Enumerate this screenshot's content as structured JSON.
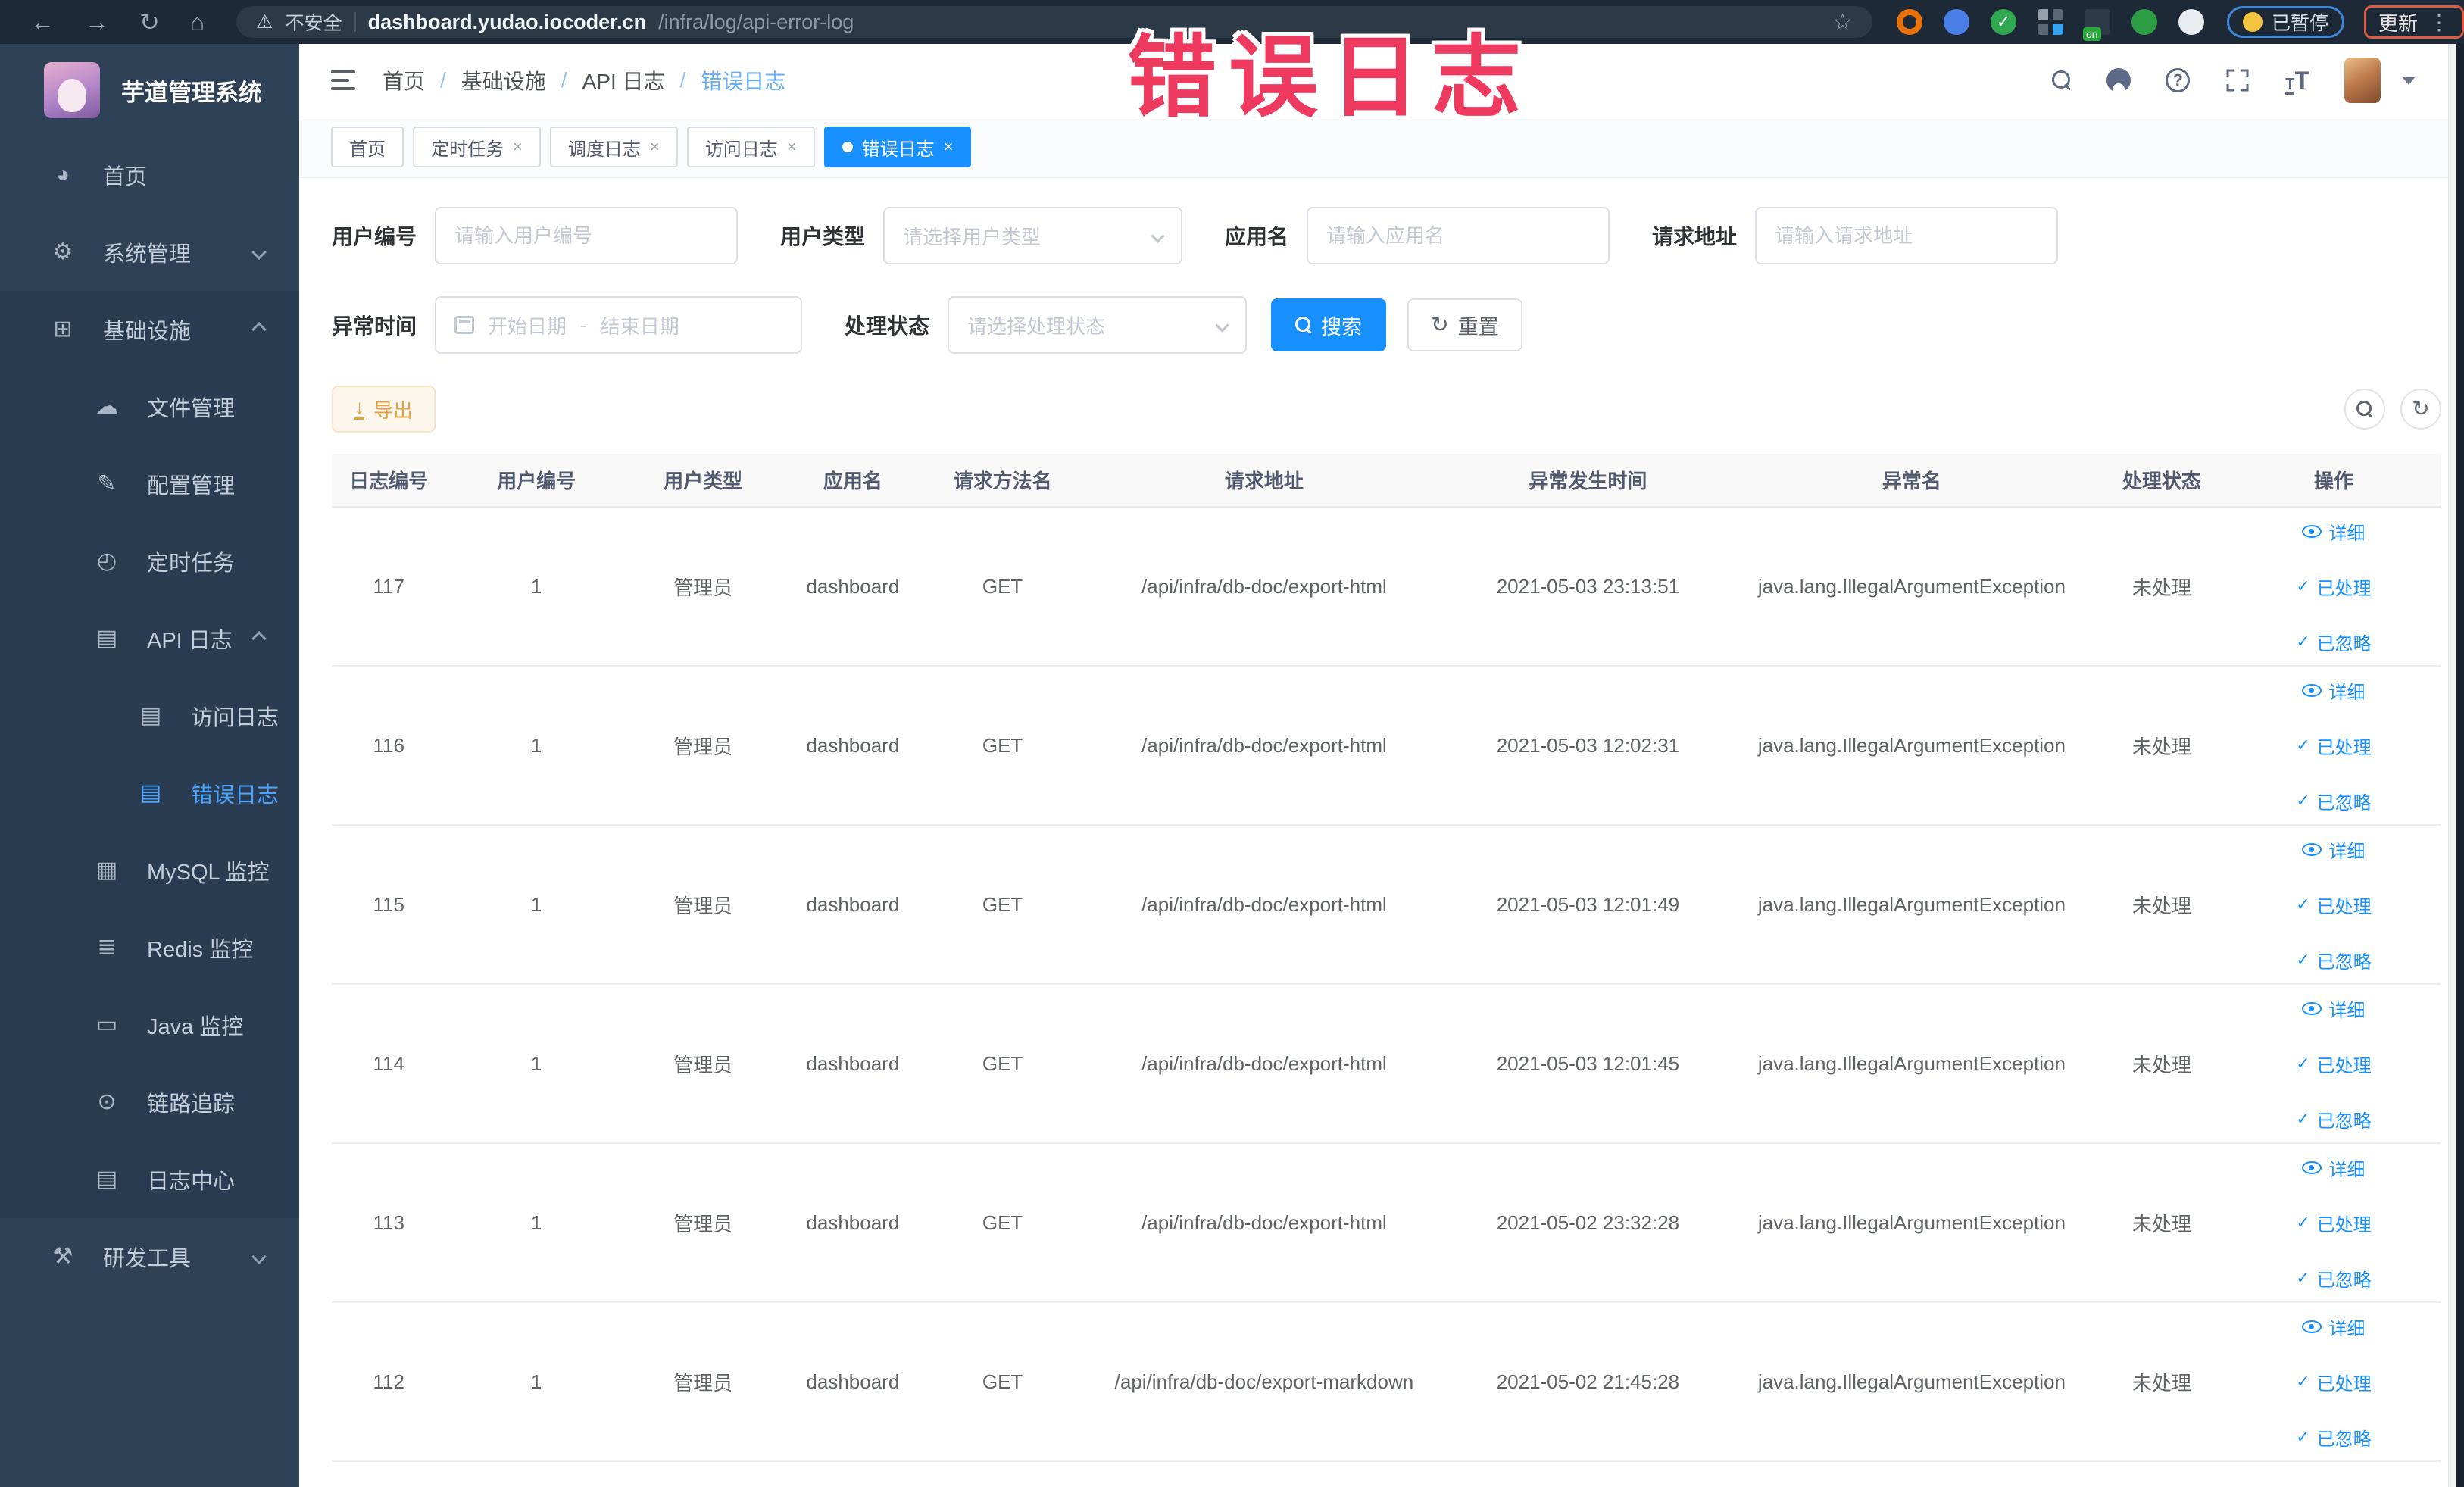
{
  "browser": {
    "security_label": "不安全",
    "url_host": "dashboard.yudao.iocoder.cn",
    "url_path": "/infra/log/api-error-log",
    "extension_badge": "on",
    "paused_badge": "已暂停",
    "update_label": "更新"
  },
  "annotation": {
    "title": "错误日志",
    "color": "#ee3a5f"
  },
  "sidebar": {
    "logo_title": "芋道管理系统",
    "items": [
      {
        "label": "首页"
      },
      {
        "label": "系统管理"
      },
      {
        "label": "基础设施"
      },
      {
        "label": "文件管理"
      },
      {
        "label": "配置管理"
      },
      {
        "label": "定时任务"
      },
      {
        "label": "API 日志"
      },
      {
        "label": "访问日志"
      },
      {
        "label": "错误日志"
      },
      {
        "label": "MySQL 监控"
      },
      {
        "label": "Redis 监控"
      },
      {
        "label": "Java 监控"
      },
      {
        "label": "链路追踪"
      },
      {
        "label": "日志中心"
      },
      {
        "label": "研发工具"
      }
    ]
  },
  "header": {
    "breadcrumb": [
      "首页",
      "基础设施",
      "API 日志",
      "错误日志"
    ],
    "separator": "/"
  },
  "tabs": [
    {
      "label": "首页"
    },
    {
      "label": "定时任务"
    },
    {
      "label": "调度日志"
    },
    {
      "label": "访问日志"
    },
    {
      "label": "错误日志"
    }
  ],
  "filters": {
    "user_id": {
      "label": "用户编号",
      "placeholder": "请输入用户编号"
    },
    "user_type": {
      "label": "用户类型",
      "placeholder": "请选择用户类型"
    },
    "app_name": {
      "label": "应用名",
      "placeholder": "请输入应用名"
    },
    "request_url": {
      "label": "请求地址",
      "placeholder": "请输入请求地址"
    },
    "exception_time": {
      "label": "异常时间",
      "start_placeholder": "开始日期",
      "separator": "-",
      "end_placeholder": "结束日期"
    },
    "process_status": {
      "label": "处理状态",
      "placeholder": "请选择处理状态"
    },
    "search_label": "搜索",
    "reset_label": "重置"
  },
  "toolbar": {
    "export_label": "导出"
  },
  "table": {
    "columns": [
      "日志编号",
      "用户编号",
      "用户类型",
      "应用名",
      "请求方法名",
      "请求地址",
      "异常发生时间",
      "异常名",
      "处理状态",
      "操作"
    ],
    "actions": [
      {
        "label": "详细"
      },
      {
        "label": "已处理"
      },
      {
        "label": "已忽略"
      }
    ],
    "rows": [
      {
        "id": "117",
        "user_id": "1",
        "user_type": "管理员",
        "app": "dashboard",
        "method": "GET",
        "url": "/api/infra/db-doc/export-html",
        "time": "2021-05-03 23:13:51",
        "exception": "java.lang.IllegalArgumentException",
        "status": "未处理"
      },
      {
        "id": "116",
        "user_id": "1",
        "user_type": "管理员",
        "app": "dashboard",
        "method": "GET",
        "url": "/api/infra/db-doc/export-html",
        "time": "2021-05-03 12:02:31",
        "exception": "java.lang.IllegalArgumentException",
        "status": "未处理"
      },
      {
        "id": "115",
        "user_id": "1",
        "user_type": "管理员",
        "app": "dashboard",
        "method": "GET",
        "url": "/api/infra/db-doc/export-html",
        "time": "2021-05-03 12:01:49",
        "exception": "java.lang.IllegalArgumentException",
        "status": "未处理"
      },
      {
        "id": "114",
        "user_id": "1",
        "user_type": "管理员",
        "app": "dashboard",
        "method": "GET",
        "url": "/api/infra/db-doc/export-html",
        "time": "2021-05-03 12:01:45",
        "exception": "java.lang.IllegalArgumentException",
        "status": "未处理"
      },
      {
        "id": "113",
        "user_id": "1",
        "user_type": "管理员",
        "app": "dashboard",
        "method": "GET",
        "url": "/api/infra/db-doc/export-html",
        "time": "2021-05-02 23:32:28",
        "exception": "java.lang.IllegalArgumentException",
        "status": "未处理"
      },
      {
        "id": "112",
        "user_id": "1",
        "user_type": "管理员",
        "app": "dashboard",
        "method": "GET",
        "url": "/api/infra/db-doc/export-markdown",
        "time": "2021-05-02 21:45:28",
        "exception": "java.lang.IllegalArgumentException",
        "status": "未处理"
      }
    ]
  },
  "colors": {
    "primary": "#1890ff",
    "sidebar_bg": "#2f4156",
    "chrome_bar_bg": "#1d2936",
    "export_warning": "#e6a23c",
    "annotation_red": "#ee3a5f"
  }
}
